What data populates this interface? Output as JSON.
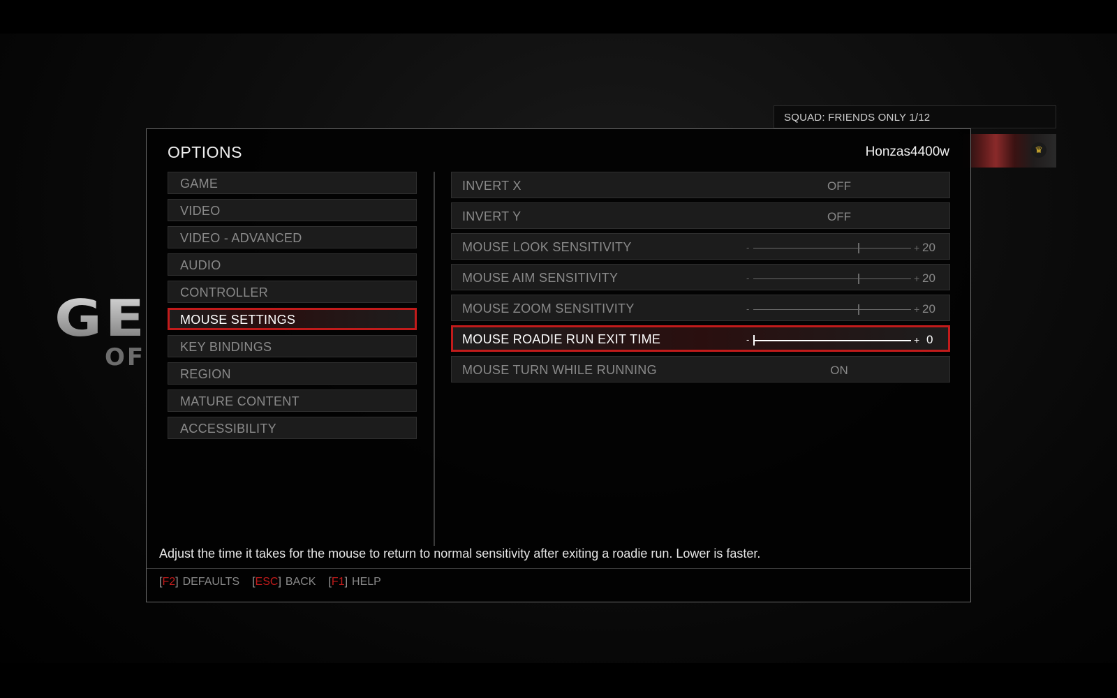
{
  "background": {
    "logo_fragment": "GE",
    "logo_sub_fragment": "OF"
  },
  "squad": {
    "label": "SQUAD: FRIENDS ONLY 1/12",
    "badge_icon": "crown-icon"
  },
  "dialog": {
    "title": "OPTIONS",
    "username": "Honzas4400w"
  },
  "categories": [
    {
      "label": "GAME",
      "selected": false
    },
    {
      "label": "VIDEO",
      "selected": false
    },
    {
      "label": "VIDEO - ADVANCED",
      "selected": false
    },
    {
      "label": "AUDIO",
      "selected": false
    },
    {
      "label": "CONTROLLER",
      "selected": false
    },
    {
      "label": "MOUSE SETTINGS",
      "selected": true
    },
    {
      "label": "KEY BINDINGS",
      "selected": false
    },
    {
      "label": "REGION",
      "selected": false
    },
    {
      "label": "MATURE CONTENT",
      "selected": false
    },
    {
      "label": "ACCESSIBILITY",
      "selected": false
    }
  ],
  "settings": [
    {
      "label": "INVERT X",
      "type": "toggle",
      "value": "OFF"
    },
    {
      "label": "INVERT Y",
      "type": "toggle",
      "value": "OFF"
    },
    {
      "label": "MOUSE LOOK SENSITIVITY",
      "type": "slider",
      "minus": "-",
      "plus": "+",
      "value": "20",
      "level": 0.67
    },
    {
      "label": "MOUSE AIM SENSITIVITY",
      "type": "slider",
      "minus": "-",
      "plus": "+",
      "value": "20",
      "level": 0.67
    },
    {
      "label": "MOUSE ZOOM SENSITIVITY",
      "type": "slider",
      "minus": "-",
      "plus": "+",
      "value": "20",
      "level": 0.67
    },
    {
      "label": "MOUSE ROADIE RUN EXIT TIME",
      "type": "slider",
      "minus": "-",
      "plus": "+",
      "value": "0",
      "level": 0.0,
      "selected": true
    },
    {
      "label": "MOUSE TURN WHILE RUNNING",
      "type": "toggle",
      "value": "ON"
    }
  ],
  "description": "Adjust the time it takes for the mouse to return to normal sensitivity after exiting a roadie run. Lower is faster.",
  "footer": {
    "hints": [
      {
        "open": "[",
        "key": "F2",
        "close": "]",
        "label": "DEFAULTS"
      },
      {
        "open": "[",
        "key": "ESC",
        "close": "]",
        "label": "BACK"
      },
      {
        "open": "[",
        "key": "F1",
        "close": "]",
        "label": "HELP"
      }
    ]
  },
  "colors": {
    "accent": "#c21b1b",
    "text_active": "#ffffff",
    "text_inactive": "#8a8a8a",
    "row_bg": "#1c1c1c",
    "crown": "#d9b330"
  }
}
